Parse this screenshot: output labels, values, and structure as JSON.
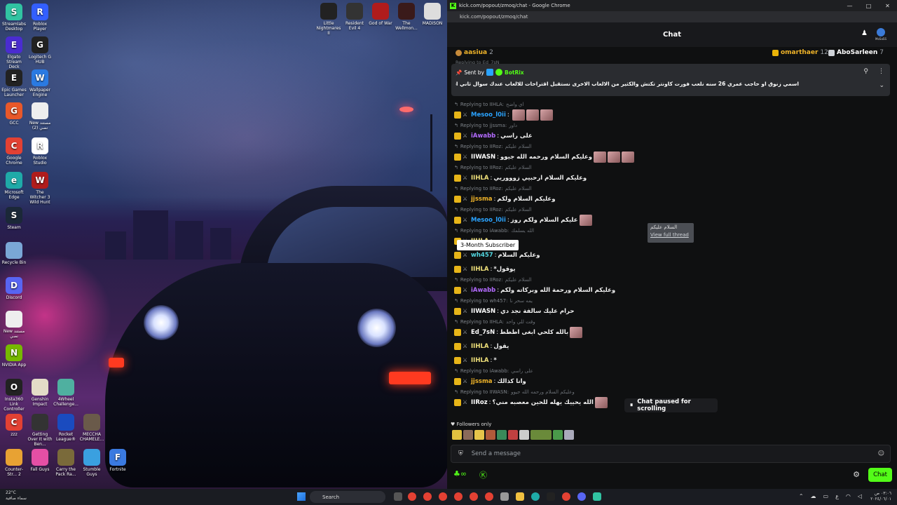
{
  "desktop_icons": [
    {
      "label": "Streamlabs Desktop",
      "color": "#31c3a2",
      "glyph": "S"
    },
    {
      "label": "Roblox Player",
      "color": "#335fff",
      "glyph": "R"
    },
    {
      "label": "Elgato Stream Deck",
      "color": "#4a2cd0",
      "glyph": "E"
    },
    {
      "label": "Logitech G HUB",
      "color": "#222",
      "glyph": "G"
    },
    {
      "label": "Epic Games Launcher",
      "color": "#222",
      "glyph": "E"
    },
    {
      "label": "Wallpaper Engine",
      "color": "#2a7ae2",
      "glyph": "W"
    },
    {
      "label": "GCC",
      "color": "#e8582a",
      "glyph": "G"
    },
    {
      "label": "New مستند نصي (2)",
      "color": "#eee",
      "glyph": ""
    },
    {
      "label": "Google Chrome",
      "color": "#e34133",
      "glyph": "C"
    },
    {
      "label": "Roblox Studio",
      "color": "#fff",
      "glyph": "R"
    },
    {
      "label": "Microsoft Edge",
      "color": "#1faaa8",
      "glyph": "e"
    },
    {
      "label": "The Witcher 3 Wild Hunt",
      "color": "#b01c1c",
      "glyph": "W"
    },
    {
      "label": "Steam",
      "color": "#1b2838",
      "glyph": "S"
    },
    {
      "label": "Recycle Bin",
      "color": "#7aa7d6",
      "glyph": ""
    },
    {
      "label": "Discord",
      "color": "#5865f2",
      "glyph": "D"
    },
    {
      "label": "New مستند نصي",
      "color": "#eee",
      "glyph": ""
    },
    {
      "label": "NVIDIA App",
      "color": "#76b900",
      "glyph": "N"
    },
    {
      "label": "Insta360 Link Controller",
      "color": "#222",
      "glyph": "O"
    },
    {
      "label": "Genshin Impact",
      "color": "#e3dcc7",
      "glyph": ""
    },
    {
      "label": "4Wheel Challenge...",
      "color": "#4fb0a0",
      "glyph": ""
    },
    {
      "label": "zzz",
      "color": "#e34133",
      "glyph": "C"
    },
    {
      "label": "Getting Over It with Ben...",
      "color": "#333",
      "glyph": ""
    },
    {
      "label": "Rocket League®",
      "color": "#1a4bbf",
      "glyph": ""
    },
    {
      "label": "MECCHA CHAMELE...",
      "color": "#6a5a4a",
      "glyph": ""
    },
    {
      "label": "Counter-Str... 2",
      "color": "#e8a233",
      "glyph": ""
    },
    {
      "label": "Fall Guys",
      "color": "#e54fa5",
      "glyph": ""
    },
    {
      "label": "Carry the Pack Ra...",
      "color": "#7a6a3a",
      "glyph": ""
    },
    {
      "label": "Stumble Guys",
      "color": "#3aa0e0",
      "glyph": ""
    },
    {
      "label": "Fortnite",
      "color": "#3a7ae0",
      "glyph": "F"
    }
  ],
  "top_icons": [
    {
      "label": "Little Nightmares II",
      "color": "#222"
    },
    {
      "label": "Resident Evil 4",
      "color": "#333"
    },
    {
      "label": "God of War",
      "color": "#b01c1c"
    },
    {
      "label": "The Wellmon...",
      "color": "#3a1a1a"
    },
    {
      "label": "MADiSON",
      "color": "#ddd"
    }
  ],
  "browser": {
    "title": "kick.com/popout/zmoq/chat - Google Chrome",
    "url": "kick.com/popout/zmoq/chat"
  },
  "chat": {
    "header_title": "Chat",
    "moss_label": "MoSaSS",
    "leaderboard": [
      {
        "name": "aasiua",
        "count": "2",
        "color": "#f0b429"
      },
      {
        "name": "omarthaer",
        "count": "12",
        "color": "#f0b429"
      },
      {
        "name": "AboSarleen",
        "count": "7",
        "color": "#ffffff"
      }
    ],
    "pinned": {
      "sent_by_label": "Sent by",
      "bot_name": "BotRix",
      "text": "اسمي زنوق او حاجب عمري 26 سنه نلعب فورت كاونتر تكتش والكثير من الالعاب الاخرى نستقبل اقتراحات للالعاب عندك سوال ثاني اسال بالشات تنوروا الليث",
      "partial_reply": "Replying to Ed_7sN"
    },
    "messages": [
      {
        "reply_to": "Replying to IIHLA:",
        "reply_text": "اي واضح",
        "user": "Mesoo_l0ii",
        "user_color": "#2aa3ff",
        "text": "",
        "emotes": 3
      },
      {
        "reply_to": "Replying to jjssma:",
        "reply_text": "داور",
        "user": "iAwabb",
        "user_color": "#b36bff",
        "text": "على راسي",
        "emotes": 0
      },
      {
        "reply_to": "Replying to IIRoz:",
        "reply_text": "السلام عليكم",
        "user": "IIWASN",
        "user_color": "#ffffff",
        "text": "وعليكم السلام ورحمه الله جيوو",
        "emotes": 3
      },
      {
        "reply_to": "Replying to IIRoz:",
        "reply_text": "السلام عليكم",
        "user": "IIHLA",
        "user_color": "#f0e17a",
        "text": "وعليكم السلام ارحبيي زوووريي",
        "emotes": 0
      },
      {
        "reply_to": "Replying to IIRoz:",
        "reply_text": "السلام عليكم",
        "user": "jjssma",
        "user_color": "#f0b429",
        "text": "وعليكم السلام ولكم",
        "emotes": 0
      },
      {
        "reply_to": "Replying to IIRoz:",
        "reply_text": "السلام عليكم",
        "user": "Mesoo_l0ii",
        "user_color": "#2aa3ff",
        "text": "عليكم السلام ولكم روز",
        "emotes": 1
      },
      {
        "reply_to": "Replying to iAwabb:",
        "reply_text": "الله يسلمك",
        "user": "IIHLA",
        "user_color": "#f0e17a",
        "text": "",
        "emotes": 0
      },
      {
        "reply_to": "",
        "reply_text": "",
        "user": "wh457",
        "user_color": "#53d6e0",
        "text": "وعليكم السلام",
        "emotes": 0
      },
      {
        "reply_to": "",
        "reply_text": "",
        "user": "IIHLA",
        "user_color": "#f0e17a",
        "text": "*يوقول",
        "emotes": 0
      },
      {
        "reply_to": "Replying to IIRoz:",
        "reply_text": "السلام عليكم",
        "user": "iAwabb",
        "user_color": "#b36bff",
        "text": "وعليكم السلام ورحمة الله وبركاته ولكم",
        "emotes": 0
      },
      {
        "reply_to": "Replying to wh457:",
        "reply_text": "يمه سحر نا",
        "user": "IIWASN",
        "user_color": "#ffffff",
        "text": "حرام عليك سالفة نجد دي",
        "emotes": 0
      },
      {
        "reply_to": "Replying to IIHLA:",
        "reply_text": "وقت للي واحد",
        "user": "Ed_7sN",
        "user_color": "#ffffff",
        "text": "بالله كلحي ابغى اططط",
        "emotes": 1
      },
      {
        "reply_to": "",
        "reply_text": "",
        "user": "IIHLA",
        "user_color": "#f0e17a",
        "text": "يقول",
        "emotes": 0
      },
      {
        "reply_to": "",
        "reply_text": "",
        "user": "IIHLA",
        "user_color": "#f0e17a",
        "text": "*",
        "emotes": 0
      },
      {
        "reply_to": "Replying to iAwabb:",
        "reply_text": "على راسي",
        "user": "jjssma",
        "user_color": "#f0b429",
        "text": "وانا كذالك",
        "emotes": 0
      },
      {
        "reply_to": "Replying to IIWASN:",
        "reply_text": "وعليكم السلام ورحمه الله جيوو",
        "user": "IIRoz",
        "user_color": "#ffffff",
        "text": "الله يحييك يهله للحين معصبه مني؟",
        "emotes": 1
      }
    ],
    "tooltip": "3-Month Subscriber",
    "thread_popup": {
      "text": "السلام عليكم",
      "link": "View full thread"
    },
    "paused_label": "Chat paused for scrolling",
    "followers_only": "Followers only",
    "input_placeholder": "Send a message",
    "send_label": "Chat"
  },
  "taskbar": {
    "weather_temp": "22°C",
    "weather_text": "سماء صافية",
    "search_label": "Search",
    "time": "٠٣:٠٦ ص",
    "date": "٢٠٢٤/٠٦/٠١"
  }
}
